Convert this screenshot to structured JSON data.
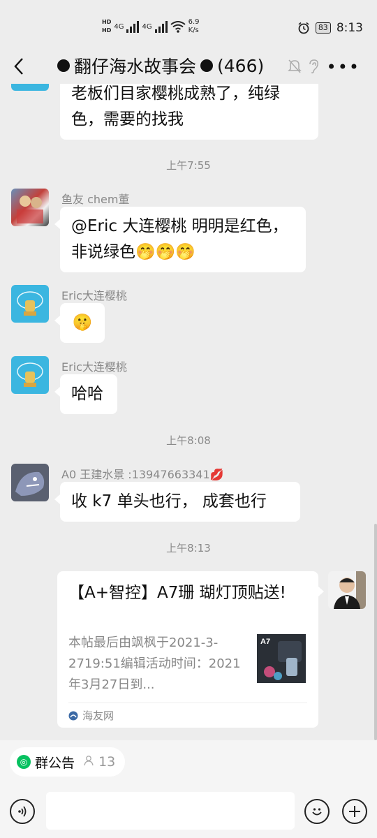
{
  "status": {
    "net1": "4G",
    "net2": "4G",
    "speed": "6.9",
    "speed_unit": "K/s",
    "battery": "83",
    "time": "8:13"
  },
  "header": {
    "title": "翻仔海水故事会",
    "member_count": "(466)"
  },
  "messages": [
    {
      "type": "text",
      "text": "老板们目家樱桃成熟了，纯绿色，需要的找我"
    },
    {
      "type": "time",
      "text": "上午7:55"
    },
    {
      "type": "text",
      "sender": "鱼友 chem董",
      "text": "@Eric 大连樱桃  明明是红色，非说绿色🤭🤭🤭"
    },
    {
      "type": "text",
      "sender": "Eric大连樱桃",
      "text": "🤫"
    },
    {
      "type": "text",
      "sender": "Eric大连樱桃",
      "text": "哈哈"
    },
    {
      "type": "time",
      "text": "上午8:08"
    },
    {
      "type": "text",
      "sender": "A0   王建水景 :13947663341💋",
      "text": "收 k7  单头也行，  成套也行"
    },
    {
      "type": "time",
      "text": "上午8:13"
    },
    {
      "type": "link_card",
      "title": "【A+智控】A7珊 瑚灯顶贴送!",
      "description": "本帖最后由飒枫于2021-3-2719:51编辑活动时间：2021年3月27日到...",
      "thumb_label": "A7",
      "source": "海友网"
    }
  ],
  "bottom": {
    "notice_label": "群公告",
    "notice_count": "13"
  },
  "colors": {
    "background": "#ededed",
    "bubble": "#ffffff",
    "accent_green": "#07c160"
  }
}
